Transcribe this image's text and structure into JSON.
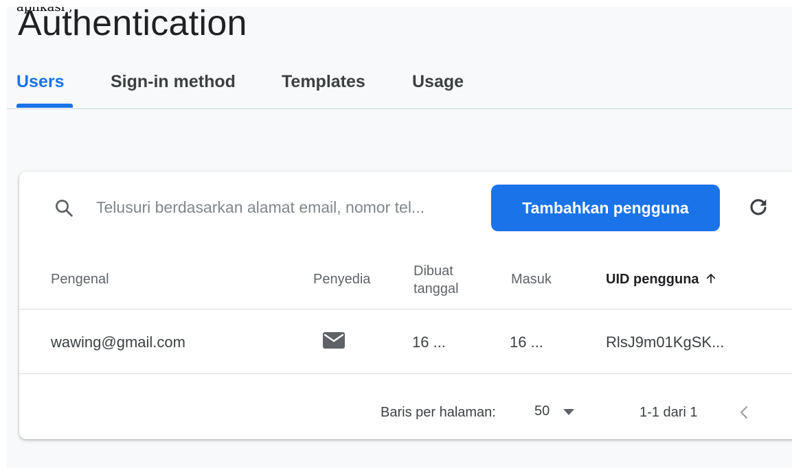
{
  "header": {
    "cropped_text": "aplikasi , ",
    "title": "Authentication"
  },
  "tabs": [
    {
      "label": "Users",
      "active": true
    },
    {
      "label": "Sign-in method",
      "active": false
    },
    {
      "label": "Templates",
      "active": false
    },
    {
      "label": "Usage",
      "active": false
    }
  ],
  "toolbar": {
    "search_placeholder": "Telusuri berdasarkan alamat email, nomor tel...",
    "add_user_label": "Tambahkan pengguna",
    "search_icon": "search-icon",
    "refresh_icon": "refresh-icon"
  },
  "table": {
    "columns": {
      "identifier": "Pengenal",
      "provider": "Penyedia",
      "created_line1": "Dibuat",
      "created_line2": "tanggal",
      "signed_in": "Masuk",
      "user_uid": "UID pengguna",
      "sorted_column": "user_uid",
      "sort_direction": "ascending"
    },
    "rows": [
      {
        "identifier": "wawing@gmail.com",
        "provider_icon": "mail-icon",
        "created": "16 ...",
        "signed_in": "16 ...",
        "user_uid": "RlsJ9m01KgSK..."
      }
    ]
  },
  "pagination": {
    "rows_per_page_label": "Baris per halaman:",
    "rows_per_page_value": "50",
    "range_text": "1-1 dari 1"
  },
  "colors": {
    "accent": "#1a73e8",
    "text_primary": "#202124",
    "text_secondary": "#5f6368",
    "page_background": "#f8f9fa",
    "divider": "#dadce0"
  }
}
